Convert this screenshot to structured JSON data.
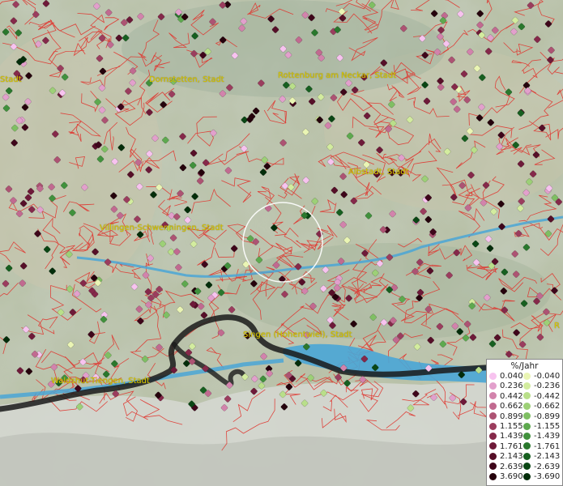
{
  "map": {
    "cities": [
      {
        "label": "Stadt"
      },
      {
        "label": "Dornstetten, Stadt"
      },
      {
        "label": "Rottenburg am Neckar, Stadt"
      },
      {
        "label": "Albstadt, Stadt"
      },
      {
        "label": "Villingen-Schwenningen, Stadt"
      },
      {
        "label": "Singen (Hohentwiel), Stadt"
      },
      {
        "label": "Waldshut-Tiengen, Stadt"
      },
      {
        "label": "R"
      }
    ],
    "colors": {
      "terrain": "#aeb8a0",
      "boundary": "#e0362f",
      "water": "#4aa6d6",
      "border": "#1a1a1a",
      "label": "#d8c800"
    }
  },
  "legend": {
    "title": "%/Jahr",
    "positive": [
      {
        "value": "0.040",
        "color": "#f7c3ef"
      },
      {
        "value": "0.236",
        "color": "#e2a0cc"
      },
      {
        "value": "0.442",
        "color": "#d283ac"
      },
      {
        "value": "0.662",
        "color": "#c16a90"
      },
      {
        "value": "0.899",
        "color": "#ad5373"
      },
      {
        "value": "1.155",
        "color": "#9b3d5e"
      },
      {
        "value": "1.439",
        "color": "#85294a"
      },
      {
        "value": "1.761",
        "color": "#6e1a39"
      },
      {
        "value": "2.143",
        "color": "#560f28"
      },
      {
        "value": "2.639",
        "color": "#3e061a"
      },
      {
        "value": "3.690",
        "color": "#25020c"
      }
    ],
    "negative": [
      {
        "value": "-0.040",
        "color": "#eaf5b4"
      },
      {
        "value": "-0.236",
        "color": "#d3ec9f"
      },
      {
        "value": "-0.442",
        "color": "#b9df8a"
      },
      {
        "value": "-0.662",
        "color": "#9dd077"
      },
      {
        "value": "-0.899",
        "color": "#7fbf63"
      },
      {
        "value": "-1.155",
        "color": "#5ea94f"
      },
      {
        "value": "-1.439",
        "color": "#41913d"
      },
      {
        "value": "-1.761",
        "color": "#2a782d"
      },
      {
        "value": "-2.143",
        "color": "#175f20"
      },
      {
        "value": "-2.639",
        "color": "#0a4614"
      },
      {
        "value": "-3.690",
        "color": "#032d0a"
      }
    ]
  }
}
